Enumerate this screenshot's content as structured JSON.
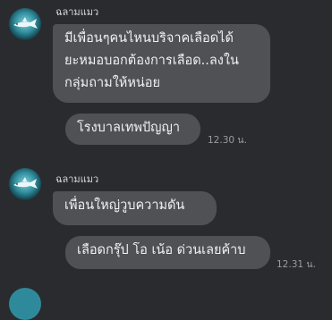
{
  "messages": [
    {
      "sender": "ฉลามแมว",
      "bubbles": [
        {
          "lines": [
            "มีเพื่อนๆคนไหนบริจาคเลือดได้",
            "ยะหมอบอกต้องการเลือด..ลงใน",
            "กลุ่มถามให้หน่อย"
          ]
        },
        {
          "lines": [
            "โรงบาลเทพปัญญา"
          ]
        }
      ],
      "time": "12.30 น."
    },
    {
      "sender": "ฉลามแมว",
      "bubbles": [
        {
          "lines": [
            "เพื่อนใหญ่วูบความดัน"
          ]
        },
        {
          "lines": [
            "เลือดกรุ๊ป โอ เน้อ ด่วนเลยค้าบ"
          ]
        }
      ],
      "time": "12.31 น."
    }
  ],
  "colors": {
    "background": "#292b2f",
    "bubble": "#4f5155",
    "text": "#f2f2f3",
    "time": "#9a9c9f"
  },
  "icons": {
    "avatar": "shark-avatar-icon"
  }
}
